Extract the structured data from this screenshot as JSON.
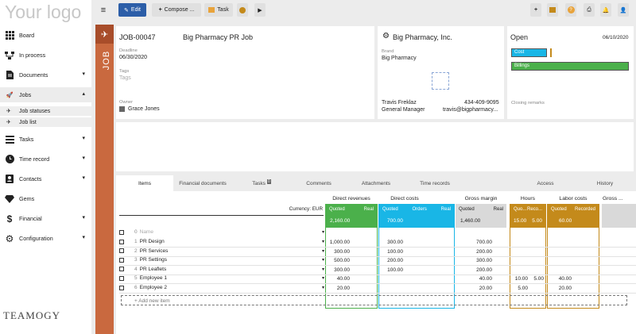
{
  "sidebar": {
    "logo": "Your logo",
    "items": [
      {
        "label": "Board",
        "icon": "grid-icon"
      },
      {
        "label": "In process",
        "icon": "flow-icon"
      },
      {
        "label": "Documents",
        "icon": "document-icon"
      },
      {
        "label": "Jobs",
        "icon": "rocket-icon"
      },
      {
        "label": "Tasks",
        "icon": "tasks-icon"
      },
      {
        "label": "Time record",
        "icon": "clock-icon"
      },
      {
        "label": "Contacts",
        "icon": "contacts-icon"
      },
      {
        "label": "Gems",
        "icon": "gem-icon"
      },
      {
        "label": "Financial",
        "icon": "dollar-icon"
      },
      {
        "label": "Configuration",
        "icon": "gear-icon"
      }
    ],
    "sub_items": [
      {
        "label": "Job statuses"
      },
      {
        "label": "Job list"
      }
    ],
    "brand": "TEAMOGY"
  },
  "toolbar": {
    "edit": "Edit",
    "compose": "Compose ...",
    "task": "Task"
  },
  "job": {
    "side_label": "JOB",
    "number": "JOB-00047",
    "title": "Big Pharmacy PR Job",
    "deadline_label": "Deadline",
    "deadline": "06/30/2020",
    "tags_label": "Tags",
    "tags_placeholder": "Tags",
    "owner_label": "Owner",
    "owner": "Grace Jones"
  },
  "client": {
    "name": "Big Pharmacy, Inc.",
    "brand_label": "Brand",
    "brand": "Big Pharmacy",
    "contact": "Travis Freklaz",
    "role": "General Manager",
    "phone": "434-409-9095",
    "email": "travis@bigpharmacy..."
  },
  "status": {
    "state": "Open",
    "date": "06/10/2020",
    "cost": "Cost",
    "billings": "Billings",
    "remarks_label": "Closing remarks"
  },
  "tabs": {
    "items": "Items",
    "financial": "Financial documents",
    "tasks": "Tasks",
    "tasks_badge": "0",
    "comments": "Comments",
    "attachments": "Attachments",
    "time_records": "Time records",
    "access": "Access",
    "history": "History"
  },
  "grid": {
    "currency": "Currency: EUR",
    "name_placeholder": "Name",
    "add_item": "Add new item",
    "groups": {
      "direct_revenues": "Direct revenues",
      "direct_costs": "Direct costs",
      "gross_margin": "Gross margin",
      "hours": "Hours",
      "labor_costs": "Labor costs",
      "gross_more": "Gross ..."
    },
    "subheads": {
      "quoted": "Quoted",
      "real": "Real",
      "orders": "Orders",
      "quo": "Quo...",
      "reco": "Reco...",
      "recorded": "Recorded"
    },
    "totals": {
      "dr_quoted": "2,160.00",
      "dc_quoted": "700.00",
      "gm_quoted": "1,460.00",
      "hours_quoted": "15.00",
      "hours_real": "5.00",
      "labor_quoted": "60.00"
    },
    "rows": [
      {
        "n": "1",
        "name": "PR Design",
        "dr": "1,000.00",
        "dc": "300.00",
        "gm": "700.00",
        "hq": "",
        "hr": "",
        "lq": ""
      },
      {
        "n": "2",
        "name": "PR Services",
        "dr": "300.00",
        "dc": "100.00",
        "gm": "200.00",
        "hq": "",
        "hr": "",
        "lq": ""
      },
      {
        "n": "3",
        "name": "PR Settings",
        "dr": "500.00",
        "dc": "200.00",
        "gm": "300.00",
        "hq": "",
        "hr": "",
        "lq": ""
      },
      {
        "n": "4",
        "name": "PR Leaflets",
        "dr": "300.00",
        "dc": "100.00",
        "gm": "200.00",
        "hq": "",
        "hr": "",
        "lq": ""
      },
      {
        "n": "5",
        "name": "Employee 1",
        "dr": "40.00",
        "dc": "",
        "gm": "40.00",
        "hq": "10.00",
        "hr": "5.00",
        "lq": "40.00"
      },
      {
        "n": "6",
        "name": "Employee 2",
        "dr": "20.00",
        "dc": "",
        "gm": "20.00",
        "hq": "5.00",
        "hr": "",
        "lq": "20.00"
      }
    ]
  }
}
